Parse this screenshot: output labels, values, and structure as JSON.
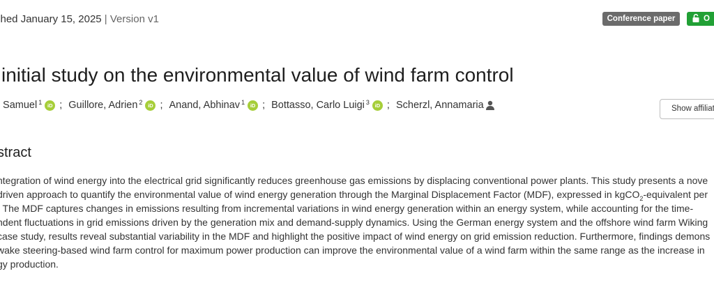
{
  "header": {
    "published_prefix": "shed",
    "published_date": "January 15, 2025",
    "separator": "|",
    "version": "Version v1",
    "badge_type": "Conference paper",
    "badge_access": "O"
  },
  "record": {
    "title": "initial study on the environmental value of wind farm control",
    "authors": [
      {
        "name": ", Samuel",
        "aff": "1"
      },
      {
        "name": "Guillore, Adrien",
        "aff": "2"
      },
      {
        "name": "Anand, Abhinav",
        "aff": "1"
      },
      {
        "name": "Bottasso, Carlo Luigi",
        "aff": "3"
      },
      {
        "name": "Scherzl, Annamaria",
        "aff": ""
      }
    ],
    "author_separator": ";",
    "orcid_label": "iD",
    "show_affiliations": "Show affiliati"
  },
  "abstract": {
    "heading": "stract",
    "lines": [
      "ntegration of wind energy into the electrical grid significantly reduces greenhouse gas emissions by displacing conventional power plants. This study presents a nove",
      "driven approach to quantify the environmental value of wind energy generation through the Marginal Displacement Factor (MDF), expressed in kgCO",
      ". The MDF captures changes in emissions resulting from incremental variations in wind energy generation within an energy system, while accounting for the time-",
      "ndent fluctuations in grid emissions driven by the generation mix and demand-supply dynamics. Using the German energy system and the offshore wind farm Wiking",
      "case study, results reveal substantial variability in the MDF and highlight the positive impact of wind energy on grid emission reduction. Furthermore, findings demons",
      "wake steering-based wind farm control for maximum power production can improve the environmental value of a wind farm within the same range as the increase in",
      "gy production."
    ],
    "line2_subscript": "2",
    "line2_tail": "-equivalent per"
  }
}
